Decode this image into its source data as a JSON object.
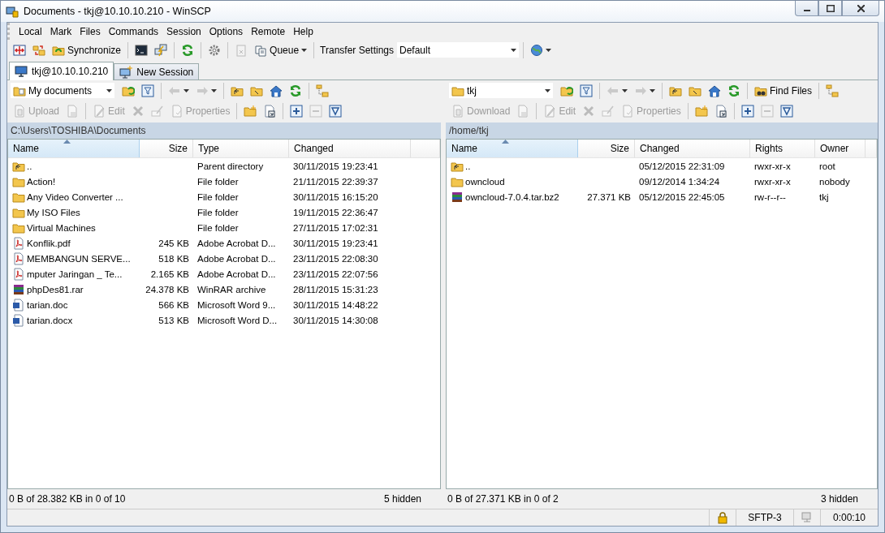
{
  "window": {
    "title": "Documents - tkj@10.10.10.210 - WinSCP"
  },
  "menu": [
    "Local",
    "Mark",
    "Files",
    "Commands",
    "Session",
    "Options",
    "Remote",
    "Help"
  ],
  "main_toolbar": [
    {
      "kind": "compare"
    },
    {
      "kind": "sync"
    },
    {
      "kind": "synchronize",
      "label": "Synchronize"
    },
    {
      "kind": "sep"
    },
    {
      "kind": "terminal"
    },
    {
      "kind": "lightning"
    },
    {
      "kind": "sep"
    },
    {
      "kind": "refresh"
    },
    {
      "kind": "sep"
    },
    {
      "kind": "gear"
    },
    {
      "kind": "sep"
    },
    {
      "kind": "clipboard",
      "disabled": true
    },
    {
      "kind": "queue",
      "label": "Queue",
      "dropdown": true
    },
    {
      "kind": "sep"
    },
    {
      "kind": "combo",
      "label": "Transfer Settings",
      "value": "Default"
    },
    {
      "kind": "sep"
    },
    {
      "kind": "globe",
      "dropdown": true
    }
  ],
  "tabs": [
    {
      "kind": "computer",
      "label": "tkj@10.10.10.210",
      "selected": true
    },
    {
      "kind": "new-session",
      "label": "New Session",
      "selected": false
    }
  ],
  "panels": [
    {
      "location": {
        "kind": "documents",
        "value": "My documents"
      },
      "nav_toolbar": [
        {
          "kind": "open-folder"
        },
        {
          "kind": "filter"
        },
        {
          "kind": "sep"
        },
        {
          "kind": "back",
          "disabled": true,
          "dropdown": true
        },
        {
          "kind": "forward",
          "disabled": true,
          "dropdown": true
        },
        {
          "kind": "sep"
        },
        {
          "kind": "up"
        },
        {
          "kind": "root"
        },
        {
          "kind": "home"
        },
        {
          "kind": "refresh"
        },
        {
          "kind": "sep"
        },
        {
          "kind": "tree"
        }
      ],
      "command_toolbar": [
        {
          "kind": "upload",
          "label": "Upload",
          "disabled": true
        },
        {
          "kind": "queue-doc",
          "disabled": true
        },
        {
          "kind": "sep"
        },
        {
          "kind": "edit",
          "label": "Edit",
          "disabled": true
        },
        {
          "kind": "delete",
          "disabled": true
        },
        {
          "kind": "rename",
          "disabled": true
        },
        {
          "kind": "properties",
          "label": "Properties",
          "disabled": true
        },
        {
          "kind": "sep"
        },
        {
          "kind": "new-folder"
        },
        {
          "kind": "shortcut"
        },
        {
          "kind": "sep"
        },
        {
          "kind": "plus"
        },
        {
          "kind": "minus",
          "disabled": true
        },
        {
          "kind": "funnel"
        }
      ],
      "path": "C:\\Users\\TOSHIBA\\Documents",
      "columns": [
        {
          "kind": "name",
          "label": "Name",
          "sorted": true
        },
        {
          "kind": "size",
          "label": "Size",
          "sorted": false
        },
        {
          "kind": "text",
          "label": "Type",
          "sorted": false
        },
        {
          "kind": "text",
          "label": "Changed",
          "sorted": false
        }
      ],
      "rows": [
        {
          "kind": "parent",
          "cells": [
            "..",
            "",
            "Parent directory",
            "30/11/2015  19:23:41"
          ]
        },
        {
          "kind": "folder",
          "cells": [
            "Action!",
            "",
            "File folder",
            "21/11/2015  22:39:37"
          ]
        },
        {
          "kind": "folder",
          "cells": [
            "Any Video Converter ...",
            "",
            "File folder",
            "30/11/2015  16:15:20"
          ]
        },
        {
          "kind": "folder",
          "cells": [
            "My ISO Files",
            "",
            "File folder",
            "19/11/2015  22:36:47"
          ]
        },
        {
          "kind": "folder",
          "cells": [
            "Virtual Machines",
            "",
            "File folder",
            "27/11/2015  17:02:31"
          ]
        },
        {
          "kind": "pdf",
          "cells": [
            "Konflik.pdf",
            "245 KB",
            "Adobe Acrobat D...",
            "30/11/2015  19:23:41"
          ]
        },
        {
          "kind": "pdf",
          "cells": [
            "MEMBANGUN SERVE...",
            "518 KB",
            "Adobe Acrobat D...",
            "23/11/2015  22:08:30"
          ]
        },
        {
          "kind": "pdf",
          "cells": [
            "mputer Jaringan _ Te...",
            "2.165 KB",
            "Adobe Acrobat D...",
            "23/11/2015  22:07:56"
          ]
        },
        {
          "kind": "archive",
          "cells": [
            "phpDes81.rar",
            "24.378 KB",
            "WinRAR archive",
            "28/11/2015  15:31:23"
          ]
        },
        {
          "kind": "word",
          "cells": [
            "tarian.doc",
            "566 KB",
            "Microsoft Word 9...",
            "30/11/2015  14:48:22"
          ]
        },
        {
          "kind": "word",
          "cells": [
            "tarian.docx",
            "513 KB",
            "Microsoft Word D...",
            "30/11/2015  14:30:08"
          ]
        }
      ],
      "status": "0 B of 28.382 KB in 0 of 10",
      "hidden": "5 hidden"
    },
    {
      "location": {
        "kind": "folder",
        "value": "tkj"
      },
      "nav_toolbar": [
        {
          "kind": "open-folder"
        },
        {
          "kind": "filter"
        },
        {
          "kind": "sep"
        },
        {
          "kind": "back",
          "disabled": true,
          "dropdown": true
        },
        {
          "kind": "forward",
          "disabled": true,
          "dropdown": true
        },
        {
          "kind": "sep"
        },
        {
          "kind": "up"
        },
        {
          "kind": "root"
        },
        {
          "kind": "home"
        },
        {
          "kind": "refresh"
        },
        {
          "kind": "sep"
        },
        {
          "kind": "find",
          "label": "Find Files"
        },
        {
          "kind": "sep"
        },
        {
          "kind": "tree"
        }
      ],
      "command_toolbar": [
        {
          "kind": "download",
          "label": "Download",
          "disabled": true
        },
        {
          "kind": "queue-doc",
          "disabled": true
        },
        {
          "kind": "sep"
        },
        {
          "kind": "edit",
          "label": "Edit",
          "disabled": true
        },
        {
          "kind": "delete",
          "disabled": true
        },
        {
          "kind": "rename",
          "disabled": true
        },
        {
          "kind": "properties",
          "label": "Properties",
          "disabled": true
        },
        {
          "kind": "sep"
        },
        {
          "kind": "new-folder"
        },
        {
          "kind": "shortcut"
        },
        {
          "kind": "sep"
        },
        {
          "kind": "plus"
        },
        {
          "kind": "minus",
          "disabled": true
        },
        {
          "kind": "funnel"
        }
      ],
      "path": "/home/tkj",
      "columns": [
        {
          "kind": "name",
          "label": "Name",
          "sorted": true
        },
        {
          "kind": "size",
          "label": "Size",
          "sorted": false
        },
        {
          "kind": "text",
          "label": "Changed",
          "sorted": false
        },
        {
          "kind": "text",
          "label": "Rights",
          "sorted": false
        },
        {
          "kind": "text",
          "label": "Owner",
          "sorted": false
        }
      ],
      "rows": [
        {
          "kind": "parent",
          "cells": [
            "..",
            "",
            "05/12/2015 22:31:09",
            "rwxr-xr-x",
            "root"
          ]
        },
        {
          "kind": "folder",
          "cells": [
            "owncloud",
            "",
            "09/12/2014 1:34:24",
            "rwxr-xr-x",
            "nobody"
          ]
        },
        {
          "kind": "archive",
          "cells": [
            "owncloud-7.0.4.tar.bz2",
            "27.371 KB",
            "05/12/2015 22:45:05",
            "rw-r--r--",
            "tkj"
          ]
        }
      ],
      "status": "0 B of 27.371 KB in 0 of 2",
      "hidden": "3 hidden"
    }
  ],
  "status_bar": {
    "protocol": "SFTP-3",
    "elapsed": "0:00:10"
  }
}
